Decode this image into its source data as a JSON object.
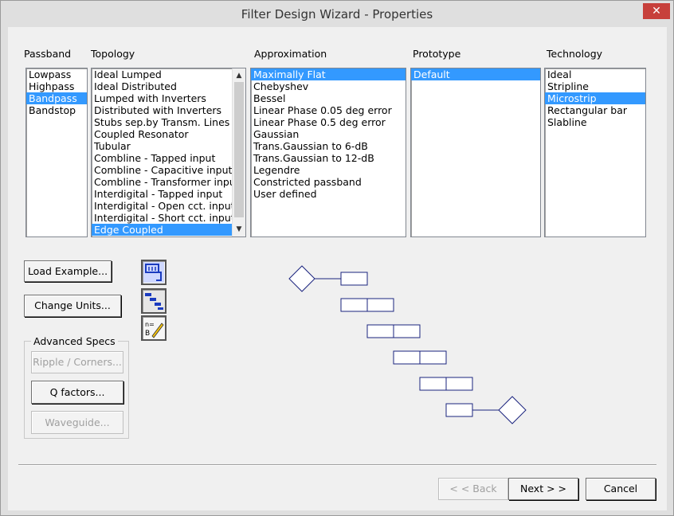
{
  "window": {
    "title": "Filter Design Wizard - Properties",
    "close_glyph": "✕"
  },
  "columns": {
    "passband": {
      "header": "Passband",
      "items": [
        "Lowpass",
        "Highpass",
        "Bandpass",
        "Bandstop"
      ],
      "selected": "Bandpass"
    },
    "topology": {
      "header": "Topology",
      "items": [
        "Ideal Lumped",
        "Ideal Distributed",
        "Lumped with Inverters",
        "Distributed with Inverters",
        "Stubs sep.by Transm. Lines",
        "Coupled Resonator",
        "Tubular",
        "Combline - Tapped input",
        "Combline - Capacitive input",
        "Combline - Transformer input",
        "Interdigital - Tapped input",
        "Interdigital - Open cct. input",
        "Interdigital - Short cct. input",
        "Edge Coupled"
      ],
      "selected": "Edge Coupled"
    },
    "approximation": {
      "header": "Approximation",
      "items": [
        "Maximally Flat",
        "Chebyshev",
        "Bessel",
        "Linear Phase 0.05 deg error",
        "Linear Phase 0.5 deg error",
        "Gaussian",
        "Trans.Gaussian to 6-dB",
        "Trans.Gaussian to 12-dB",
        "Legendre",
        "Constricted passband",
        "User defined"
      ],
      "selected": "Maximally Flat"
    },
    "prototype": {
      "header": "Prototype",
      "items": [
        "Default"
      ],
      "selected": "Default"
    },
    "technology": {
      "header": "Technology",
      "items": [
        "Ideal",
        "Stripline",
        "Microstrip",
        "Rectangular bar",
        "Slabline"
      ],
      "selected": "Microstrip"
    }
  },
  "buttons": {
    "load_example": "Load Example...",
    "change_units": "Change Units...",
    "ripple_corners": "Ripple / Corners...",
    "q_factors": "Q factors...",
    "waveguide": "Waveguide...",
    "back": "< < Back",
    "next": "Next > >",
    "cancel": "Cancel"
  },
  "advanced_specs": {
    "label": "Advanced Specs"
  },
  "toolbar_icons": [
    "schematic-view-icon",
    "layout-view-icon",
    "parameter-edit-icon"
  ],
  "colors": {
    "selection": "#3399ff",
    "diagram_stroke": "#1a237e"
  }
}
